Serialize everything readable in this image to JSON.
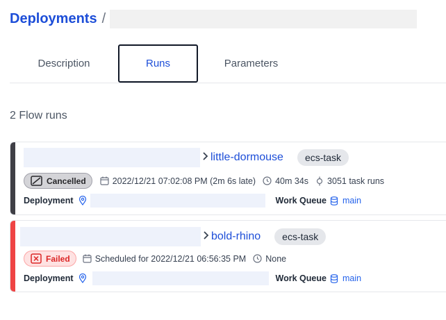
{
  "breadcrumb": {
    "root": "Deployments",
    "separator": "/"
  },
  "tabs": [
    {
      "label": "Description"
    },
    {
      "label": "Runs"
    },
    {
      "label": "Parameters"
    }
  ],
  "active_tab": "Runs",
  "run_count": "2 Flow runs",
  "runs": [
    {
      "name": "little-dormouse",
      "tag": "ecs-task",
      "state": "Cancelled",
      "date": "2022/12/21 07:02:08 PM (2m 6s late)",
      "duration": "40m 34s",
      "task_runs": "3051 task runs",
      "deployment_label": "Deployment",
      "work_queue_label": "Work Queue",
      "work_queue": "main",
      "accent": "#3f3f46"
    },
    {
      "name": "bold-rhino",
      "tag": "ecs-task",
      "state": "Failed",
      "date": "Scheduled for 2022/12/21 06:56:35 PM",
      "duration": "None",
      "deployment_label": "Deployment",
      "work_queue_label": "Work Queue",
      "work_queue": "main",
      "accent": "#ef4444"
    }
  ],
  "icons": {
    "chevron": "chevron-right-icon",
    "calendar": "calendar-icon",
    "clock": "clock-icon",
    "task": "task-run-icon",
    "location": "map-pin-icon",
    "database": "database-icon",
    "cancel_state": "cancel-square-icon",
    "fail_state": "x-square-icon"
  },
  "colors": {
    "link": "#1d4ed8",
    "cancelled": "#3f3f46",
    "failed": "#ef4444"
  }
}
